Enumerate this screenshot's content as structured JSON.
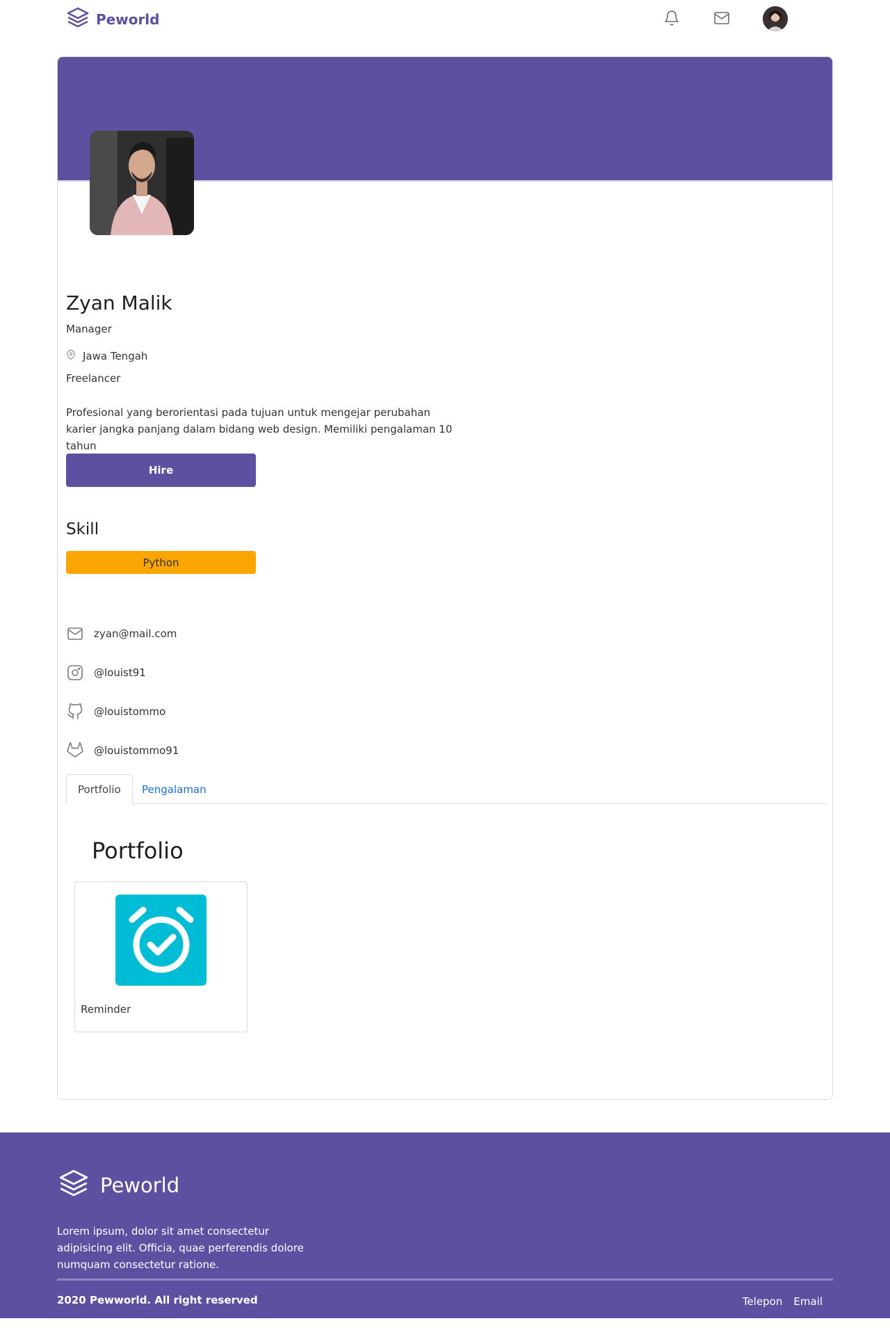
{
  "navbar": {
    "brand": "Peworld",
    "icons": [
      "bell-icon",
      "mail-icon"
    ],
    "avatar": "user-avatar"
  },
  "profile": {
    "name": "Zyan Malik",
    "job": "Manager",
    "location": "Jawa Tengah",
    "work_type": "Freelancer",
    "bio": "Profesional yang berorientasi pada tujuan untuk mengejar perubahan karier jangka panjang dalam bidang web design. Memiliki pengalaman 10 tahun",
    "hire_label": "Hire",
    "skill_title": "Skill",
    "skills": [
      "Python"
    ],
    "skill_color": "#FBA500"
  },
  "contacts": {
    "email": "zyan@mail.com",
    "instagram": "@louist91",
    "github": "@louistommo",
    "gitlab": "@louistommo91"
  },
  "tabs": [
    {
      "label": "Portfolio",
      "active": true
    },
    {
      "label": "Pengalaman",
      "active": false
    }
  ],
  "portfolio": {
    "title": "Portfolio",
    "items": [
      {
        "label": "Reminder",
        "icon": "alarm-check-icon",
        "color": "#00BCD4"
      }
    ]
  },
  "footer": {
    "brand": "Peworld",
    "description": "Lorem ipsum, dolor sit amet consectetur adipisicing elit. Officia, quae perferendis dolore numquam consectetur ratione.",
    "copyright": "2020 Pewworld. All right reserved",
    "links": [
      "Telepon",
      "Email"
    ]
  },
  "colors": {
    "brand": "#5E50A1",
    "skill": "#FBA500",
    "tab_link": "#1a6fd4"
  }
}
